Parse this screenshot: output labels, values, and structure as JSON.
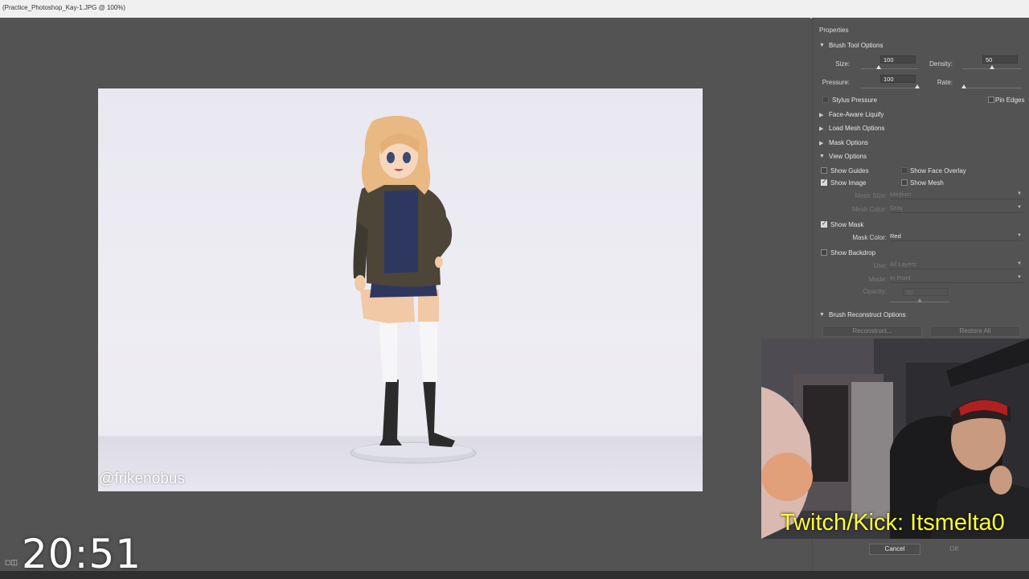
{
  "window": {
    "title": "(Practice_Photoshop_Kay-1.JPG @ 100%)"
  },
  "canvas": {
    "watermark": "@frikenobus"
  },
  "properties": {
    "title": "Properties",
    "brush_tool": {
      "header": "Brush Tool Options",
      "size_label": "Size:",
      "size_value": "100",
      "size_level": 0.3,
      "density_label": "Density:",
      "density_value": "50",
      "density_level": 0.5,
      "pressure_label": "Pressure:",
      "pressure_value": "100",
      "pressure_level": 1.0,
      "rate_label": "Rate:",
      "rate_level": 0.0,
      "stylus_pressure_label": "Stylus Pressure",
      "pin_edges_label": "Pin Edges"
    },
    "face_aware": "Face-Aware Liquify",
    "load_mesh": "Load Mesh Options",
    "mask_options": "Mask Options",
    "view_options": {
      "header": "View Options",
      "show_guides": "Show Guides",
      "show_face_overlay": "Show Face Overlay",
      "show_image": "Show Image",
      "show_mesh": "Show Mesh",
      "mesh_size_label": "Mesh Size:",
      "mesh_size_value": "Medium",
      "mesh_color_label": "Mesh Color:",
      "mesh_color_value": "Gray",
      "show_mask": "Show Mask",
      "mask_color_label": "Mask Color:",
      "mask_color_value": "Red",
      "show_backdrop": "Show Backdrop",
      "use_label": "Use:",
      "use_value": "All Layers",
      "mode_label": "Mode:",
      "mode_value": "In Front",
      "opacity_label": "Opacity:",
      "opacity_value": "50"
    },
    "reconstruct": {
      "header": "Brush Reconstruct Options",
      "reconstruct_btn": "Reconstruct...",
      "restore_btn": "Restore All"
    },
    "cancel": "Cancel",
    "ok": "OK"
  },
  "overlay": {
    "stream_text": "Twitch/Kick: Itsmelta0",
    "timer": "20:51"
  }
}
